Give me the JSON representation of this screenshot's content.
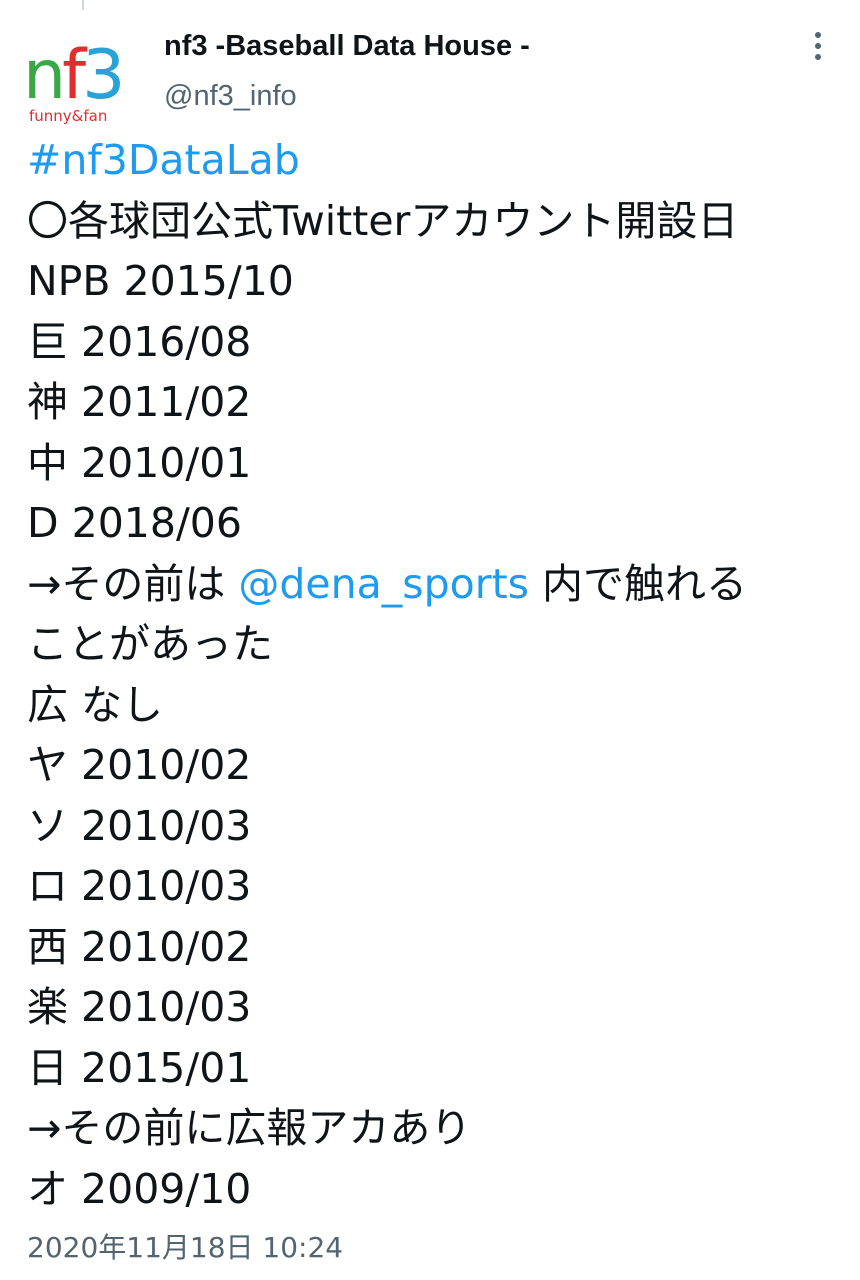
{
  "account": {
    "display_name": "nf3 -Baseball Data House -",
    "handle": "@nf3_info",
    "avatar_logo_text": "nf3",
    "avatar_tagline": "funny&fan"
  },
  "tweet": {
    "hashtag": "#nf3DataLab",
    "heading": "〇各球団公式Twitterアカウント開設日",
    "lines": [
      "NPB 2015/10",
      "巨 2016/08",
      "神 2011/02",
      "中 2010/01",
      "D 2018/06"
    ],
    "note1_before": "→その前は ",
    "note1_mention": "@dena_sports",
    "note1_after": " 内で触れる",
    "note1_cont": "ことがあった",
    "lines2": [
      "広 なし",
      "ヤ 2010/02",
      "ソ 2010/03",
      "ロ 2010/03",
      "西 2010/02",
      "楽 2010/03",
      "日 2015/01"
    ],
    "note2": "→その前に広報アカあり",
    "last_line": "オ 2009/10"
  },
  "meta": {
    "timestamp": "2020年11月18日 10:24"
  },
  "colors": {
    "link": "#1d9bf0",
    "text": "#0f1419",
    "secondary": "#536471",
    "logo_green": "#3aa845",
    "logo_red": "#e02e2e",
    "logo_blue": "#27a3d6"
  }
}
